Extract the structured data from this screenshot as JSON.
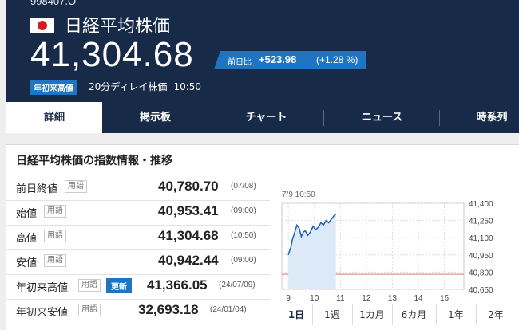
{
  "header": {
    "code": "998407.O",
    "name": "日経平均株価",
    "price": "41,304.68",
    "change_label": "前日比",
    "change_value": "+523.98",
    "change_pct": "(+1.28 %)",
    "ytd_badge": "年初来高値",
    "delay_text": "20分ディレイ株価",
    "time": "10:50"
  },
  "tabs": [
    "詳細",
    "掲示板",
    "チャート",
    "ニュース",
    "時系列"
  ],
  "panel": {
    "title": "日経平均株価の指数情報・推移",
    "term_label": "用語",
    "update_label": "更新",
    "rows": [
      {
        "label": "前日終値",
        "value": "40,780.70",
        "date": "(07/08)"
      },
      {
        "label": "始値",
        "value": "40,953.41",
        "date": "(09:00)"
      },
      {
        "label": "高値",
        "value": "41,304.68",
        "date": "(10:50)"
      },
      {
        "label": "安値",
        "value": "40,942.44",
        "date": "(09:00)"
      },
      {
        "label": "年初来高値",
        "value": "41,366.05",
        "date": "(24/07/09)"
      },
      {
        "label": "年初来安値",
        "value": "32,693.18",
        "date": "(24/01/04)"
      }
    ]
  },
  "chart_data": {
    "type": "line",
    "timestamp": "7/9 10:50",
    "x_ticks": [
      "9",
      "10",
      "11",
      "12",
      "13",
      "14",
      "15"
    ],
    "y_ticks": [
      "41,400",
      "41,250",
      "41,100",
      "40,950",
      "40,800",
      "40,650"
    ],
    "ylim": [
      40650,
      41400
    ],
    "prev_close": 40780.7,
    "series": [
      {
        "x": [
          9.0,
          9.1,
          9.15,
          9.25,
          9.33,
          9.42,
          9.5,
          9.58,
          9.65,
          9.75,
          9.85,
          9.95,
          10.05,
          10.15,
          10.25,
          10.35,
          10.45,
          10.55,
          10.65,
          10.75,
          10.83
        ],
        "values": [
          40950,
          41020,
          41080,
          41150,
          41210,
          41180,
          41110,
          41150,
          41160,
          41120,
          41150,
          41200,
          41170,
          41190,
          41230,
          41210,
          41250,
          41230,
          41260,
          41290,
          41305
        ]
      }
    ],
    "line_color": "#1e60b8",
    "fill_color": "#dce9f7",
    "prev_close_color": "#f0a0a0"
  },
  "chart_tabs": [
    "1日",
    "1週",
    "1カ月",
    "6カ月",
    "1年",
    "2年"
  ]
}
